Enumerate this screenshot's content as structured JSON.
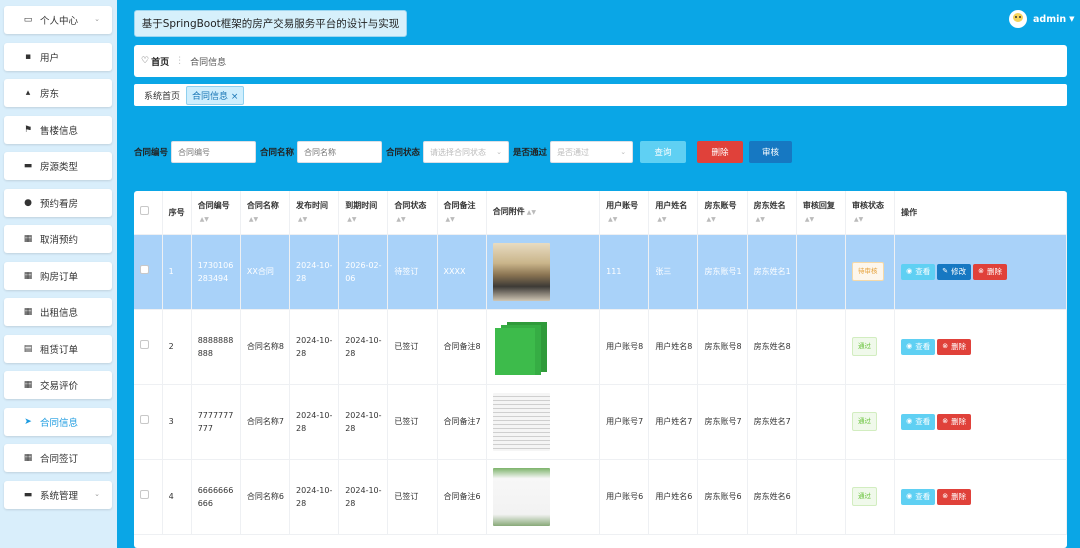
{
  "app": {
    "title": "基于SpringBoot框架的房产交易服务平台的设计与实现",
    "user": "admin"
  },
  "sidebar": {
    "items": [
      {
        "label": "个人中心",
        "icon": "monitor-icon",
        "glyph": "▭",
        "chevron": true
      },
      {
        "label": "用户",
        "icon": "user-card-icon",
        "glyph": "▪",
        "chevron": false
      },
      {
        "label": "房东",
        "icon": "thumb-icon",
        "glyph": "▴",
        "chevron": false
      },
      {
        "label": "售楼信息",
        "icon": "flag-icon",
        "glyph": "⚑",
        "chevron": false
      },
      {
        "label": "房源类型",
        "icon": "tag-icon",
        "glyph": "▬",
        "chevron": false
      },
      {
        "label": "预约看房",
        "icon": "location-icon",
        "glyph": "●",
        "chevron": false
      },
      {
        "label": "取消预约",
        "icon": "grid-icon",
        "glyph": "▦",
        "chevron": false
      },
      {
        "label": "购房订单",
        "icon": "grid-icon",
        "glyph": "▦",
        "chevron": false
      },
      {
        "label": "出租信息",
        "icon": "grid-icon",
        "glyph": "▦",
        "chevron": false
      },
      {
        "label": "租赁订单",
        "icon": "list-icon",
        "glyph": "▤",
        "chevron": false
      },
      {
        "label": "交易评价",
        "icon": "grid-icon",
        "glyph": "▦",
        "chevron": false
      },
      {
        "label": "合同信息",
        "icon": "send-icon",
        "glyph": "➤",
        "chevron": false,
        "active": true
      },
      {
        "label": "合同签订",
        "icon": "grid-icon",
        "glyph": "▦",
        "chevron": false
      },
      {
        "label": "系统管理",
        "icon": "settings-icon",
        "glyph": "▬",
        "chevron": true
      }
    ]
  },
  "breadcrumb": {
    "home": "首页",
    "separator": "⋮",
    "current": "合同信息"
  },
  "tabs": [
    {
      "label": "系统首页",
      "active": false
    },
    {
      "label": "合同信息 ×",
      "active": true
    }
  ],
  "search": {
    "contract_no_label": "合同编号",
    "contract_no_placeholder": "合同编号",
    "contract_name_label": "合同名称",
    "contract_name_placeholder": "合同名称",
    "status_label": "合同状态",
    "status_placeholder": "请选择合同状态",
    "pass_label": "是否通过",
    "pass_placeholder": "是否通过",
    "query_button": "查询",
    "delete_button": "删除",
    "review_button": "审核"
  },
  "table": {
    "columns": [
      "",
      "序号",
      "合同编号",
      "合同名称",
      "发布时间",
      "到期时间",
      "合同状态",
      "合同备注",
      "合同附件",
      "用户账号",
      "用户姓名",
      "房东账号",
      "房东姓名",
      "审核回复",
      "审核状态",
      "操作"
    ],
    "rows": [
      {
        "index": "1",
        "contract_no": "1730106283494",
        "name": "XX合同",
        "publish": "2024-10-28",
        "expire": "2026-02-06",
        "status": "待签订",
        "remark": "XXXX",
        "attachment": "living-room-photo",
        "user_acct": "111",
        "user_name": "张三",
        "owner_acct": "房东账号1",
        "owner_name": "房东姓名1",
        "reply": "",
        "review": "待审核",
        "review_kind": "pending",
        "selected": true,
        "actions": [
          "查看",
          "修改",
          "删除"
        ]
      },
      {
        "index": "2",
        "contract_no": "8888888888",
        "name": "合同名称8",
        "publish": "2024-10-28",
        "expire": "2024-10-28",
        "status": "已签订",
        "remark": "合同备注8",
        "attachment": "green-folders-photo",
        "user_acct": "用户账号8",
        "user_name": "用户姓名8",
        "owner_acct": "房东账号8",
        "owner_name": "房东姓名8",
        "reply": "",
        "review": "通过",
        "review_kind": "pass",
        "selected": false,
        "actions": [
          "查看",
          "删除"
        ]
      },
      {
        "index": "3",
        "contract_no": "7777777777",
        "name": "合同名称7",
        "publish": "2024-10-28",
        "expire": "2024-10-28",
        "status": "已签订",
        "remark": "合同备注7",
        "attachment": "document-photo",
        "user_acct": "用户账号7",
        "user_name": "用户姓名7",
        "owner_acct": "房东账号7",
        "owner_name": "房东姓名7",
        "reply": "",
        "review": "通过",
        "review_kind": "pass",
        "selected": false,
        "actions": [
          "查看",
          "删除"
        ]
      },
      {
        "index": "4",
        "contract_no": "6666666666",
        "name": "合同名称6",
        "publish": "2024-10-28",
        "expire": "2024-10-28",
        "status": "已签订",
        "remark": "合同备注6",
        "attachment": "contract-paper-photo",
        "user_acct": "用户账号6",
        "user_name": "用户姓名6",
        "owner_acct": "房东账号6",
        "owner_name": "房东姓名6",
        "reply": "",
        "review": "通过",
        "review_kind": "pass",
        "selected": false,
        "actions": [
          "查看",
          "删除"
        ]
      }
    ]
  },
  "colors": {
    "accent": "#0aa6e6",
    "selected_row": "#a9d2f9",
    "query": "#5fd0f3",
    "delete": "#e0413a",
    "review": "#1678c2"
  }
}
